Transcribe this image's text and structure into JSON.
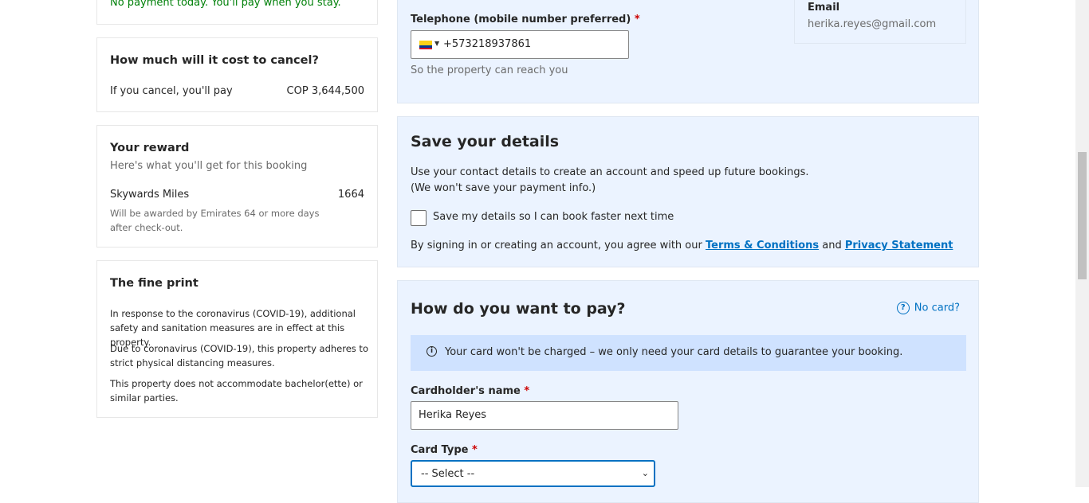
{
  "left": {
    "payment_note": "No payment today. You'll pay when you stay.",
    "cancel": {
      "title": "How much will it cost to cancel?",
      "label": "If you cancel, you'll pay",
      "amount": "COP 3,644,500"
    },
    "reward": {
      "title": "Your reward",
      "subtitle": "Here's what you'll get for this booking",
      "program": "Skywards Miles",
      "miles": "1664",
      "note": "Will be awarded by Emirates 64 or more days after check-out."
    },
    "fine_print": {
      "title": "The fine print",
      "items": [
        "In response to the coronavirus (COVID-19), additional safety and sanitation measures are in effect at this property.",
        "Due to coronavirus (COVID-19), this property adheres to strict physical distancing measures.",
        "This property does not accommodate bachelor(ette) or similar parties."
      ]
    }
  },
  "contact": {
    "phone_label": "Telephone (mobile number preferred)",
    "required_mark": "*",
    "phone_value": "+573218937861",
    "phone_hint": "So the property can reach you",
    "email_label": "Email",
    "email_value": "herika.reyes@gmail.com"
  },
  "save_details": {
    "title": "Save your details",
    "line1": "Use your contact details to create an account and speed up future bookings.",
    "line2": "(We won't save your payment info.)",
    "checkbox_label": "Save my details so I can book faster next time",
    "agree_prefix": "By signing in or creating an account, you agree with our",
    "terms_link": "Terms & Conditions",
    "and": "and",
    "privacy_link": "Privacy Statement"
  },
  "payment": {
    "title": "How do you want to pay?",
    "no_card": "No card?",
    "info": "Your card won't be charged – we only need your card details to guarantee your booking.",
    "cardholder_label": "Cardholder's name",
    "cardholder_value": "Herika Reyes",
    "card_type_label": "Card Type",
    "card_type_selected": "-- Select --"
  },
  "colors": {
    "panel_bg": "#ebf3ff",
    "info_bg": "#cfe2ff",
    "link": "#0071c2",
    "green": "#008009",
    "required": "#cc0000"
  }
}
